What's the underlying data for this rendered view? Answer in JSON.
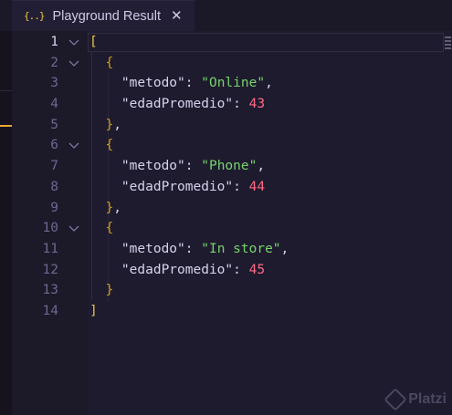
{
  "tab": {
    "icon": "{..}",
    "icon_name": "json-braces-icon",
    "title": "Playground Result",
    "close_glyph": "✕"
  },
  "editor": {
    "active_line": 1,
    "lines": [
      {
        "n": "1",
        "fold": true,
        "tokens": [
          {
            "t": "[",
            "c": "br1"
          }
        ]
      },
      {
        "n": "2",
        "fold": true,
        "tokens": [
          {
            "t": "  "
          },
          {
            "t": "{",
            "c": "br2"
          }
        ]
      },
      {
        "n": "3",
        "fold": false,
        "tokens": [
          {
            "t": "    "
          },
          {
            "t": "\"metodo\"",
            "c": "key"
          },
          {
            "t": ": ",
            "c": "punc"
          },
          {
            "t": "\"Online\"",
            "c": "str"
          },
          {
            "t": ",",
            "c": "punc"
          }
        ]
      },
      {
        "n": "4",
        "fold": false,
        "tokens": [
          {
            "t": "    "
          },
          {
            "t": "\"edadPromedio\"",
            "c": "key"
          },
          {
            "t": ": ",
            "c": "punc"
          },
          {
            "t": "43",
            "c": "num"
          }
        ]
      },
      {
        "n": "5",
        "fold": false,
        "tokens": [
          {
            "t": "  "
          },
          {
            "t": "}",
            "c": "br2"
          },
          {
            "t": ",",
            "c": "punc"
          }
        ]
      },
      {
        "n": "6",
        "fold": true,
        "tokens": [
          {
            "t": "  "
          },
          {
            "t": "{",
            "c": "br2"
          }
        ]
      },
      {
        "n": "7",
        "fold": false,
        "tokens": [
          {
            "t": "    "
          },
          {
            "t": "\"metodo\"",
            "c": "key"
          },
          {
            "t": ": ",
            "c": "punc"
          },
          {
            "t": "\"Phone\"",
            "c": "str"
          },
          {
            "t": ",",
            "c": "punc"
          }
        ]
      },
      {
        "n": "8",
        "fold": false,
        "tokens": [
          {
            "t": "    "
          },
          {
            "t": "\"edadPromedio\"",
            "c": "key"
          },
          {
            "t": ": ",
            "c": "punc"
          },
          {
            "t": "44",
            "c": "num"
          }
        ]
      },
      {
        "n": "9",
        "fold": false,
        "tokens": [
          {
            "t": "  "
          },
          {
            "t": "}",
            "c": "br2"
          },
          {
            "t": ",",
            "c": "punc"
          }
        ]
      },
      {
        "n": "10",
        "fold": true,
        "tokens": [
          {
            "t": "  "
          },
          {
            "t": "{",
            "c": "br2"
          }
        ]
      },
      {
        "n": "11",
        "fold": false,
        "tokens": [
          {
            "t": "    "
          },
          {
            "t": "\"metodo\"",
            "c": "key"
          },
          {
            "t": ": ",
            "c": "punc"
          },
          {
            "t": "\"In store\"",
            "c": "str"
          },
          {
            "t": ",",
            "c": "punc"
          }
        ]
      },
      {
        "n": "12",
        "fold": false,
        "tokens": [
          {
            "t": "    "
          },
          {
            "t": "\"edadPromedio\"",
            "c": "key"
          },
          {
            "t": ": ",
            "c": "punc"
          },
          {
            "t": "45",
            "c": "num"
          }
        ]
      },
      {
        "n": "13",
        "fold": false,
        "tokens": [
          {
            "t": "  "
          },
          {
            "t": "}",
            "c": "br2"
          }
        ]
      },
      {
        "n": "14",
        "fold": false,
        "tokens": [
          {
            "t": "]",
            "c": "br1"
          }
        ]
      }
    ]
  },
  "watermark": {
    "text": "Platzi",
    "icon_name": "platzi-logo-icon"
  },
  "colors": {
    "background": "#1e1b2e",
    "string": "#77d36f",
    "number": "#ff6a86",
    "bracket": "#e8c547",
    "line_number": "#6d6891"
  }
}
